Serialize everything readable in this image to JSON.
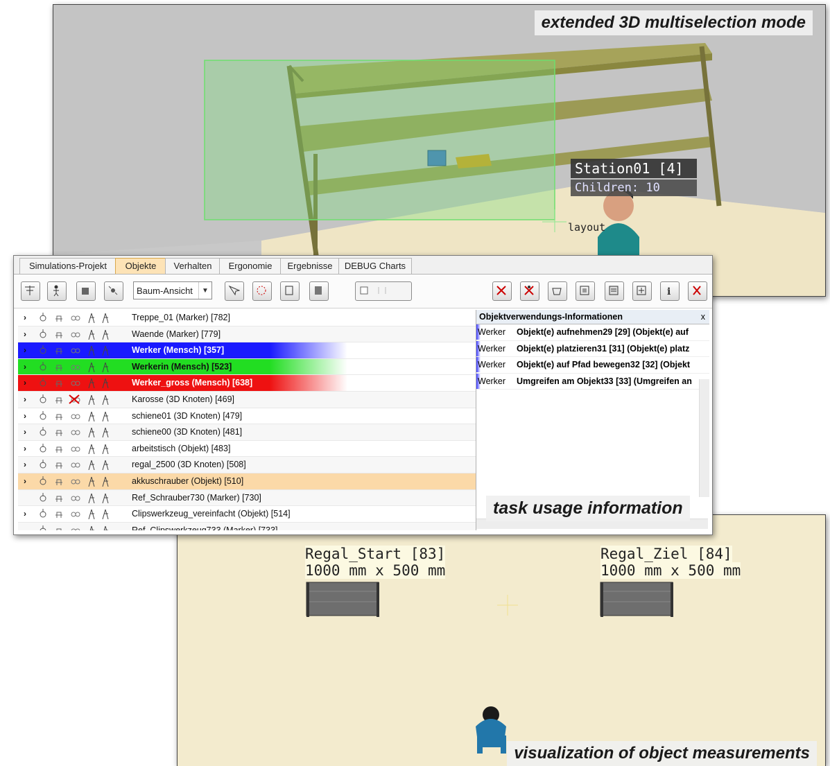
{
  "captions": {
    "top": "extended 3D multiselection mode",
    "middle": "task usage information",
    "bottom": "visualization of object measurements"
  },
  "view3d": {
    "station_label": "Station01 [4]",
    "children_label": "Children: 10",
    "layout_label": "layout"
  },
  "view2d": {
    "shelf_left_name": "Regal_Start [83]",
    "shelf_left_size": "1000 mm x 500 mm",
    "shelf_right_name": "Regal_Ziel [84]",
    "shelf_right_size": "1000 mm x 500 mm"
  },
  "tabs": [
    {
      "label": "Simulations-Projekt",
      "active": false
    },
    {
      "label": "Objekte",
      "active": true
    },
    {
      "label": "Verhalten",
      "active": false
    },
    {
      "label": "Ergonomie",
      "active": false
    },
    {
      "label": "Ergebnisse",
      "active": false
    },
    {
      "label": "DEBUG Charts",
      "active": false
    }
  ],
  "toolbar": {
    "view_select": "Baum-Ansicht"
  },
  "tree": [
    {
      "label": "Treppe_01 (Marker) [782]",
      "expand": true,
      "highlight": ""
    },
    {
      "label": "Waende (Marker) [779]",
      "expand": true,
      "highlight": ""
    },
    {
      "label": "Werker (Mensch) [357]",
      "expand": true,
      "highlight": "blue"
    },
    {
      "label": "Werkerin (Mensch) [523]",
      "expand": true,
      "highlight": "green"
    },
    {
      "label": "Werker_gross (Mensch) [638]",
      "expand": true,
      "highlight": "red"
    },
    {
      "label": "Karosse (3D Knoten) [469]",
      "expand": true,
      "highlight": ""
    },
    {
      "label": "schiene01 (3D Knoten) [479]",
      "expand": true,
      "highlight": ""
    },
    {
      "label": "schiene00 (3D Knoten) [481]",
      "expand": true,
      "highlight": ""
    },
    {
      "label": "arbeitstisch (Objekt) [483]",
      "expand": true,
      "highlight": ""
    },
    {
      "label": "regal_2500 (3D Knoten) [508]",
      "expand": true,
      "highlight": ""
    },
    {
      "label": "akkuschrauber (Objekt) [510]",
      "expand": true,
      "highlight": "selected"
    },
    {
      "label": "Ref_Schrauber730 (Marker) [730]",
      "expand": false,
      "highlight": ""
    },
    {
      "label": "Clipswerkzeug_vereinfacht (Objekt) [514]",
      "expand": true,
      "highlight": ""
    },
    {
      "label": "Ref_Clipswerkzeug733 (Marker) [733]",
      "expand": false,
      "highlight": ""
    }
  ],
  "info": {
    "title": "Objektverwendungs-Informationen",
    "close": "x",
    "rows": [
      {
        "who": "Werker",
        "what": "Objekt(e) aufnehmen29 [29] (Objekt(e) auf"
      },
      {
        "who": "Werker",
        "what": "Objekt(e) platzieren31 [31] (Objekt(e) platz"
      },
      {
        "who": "Werker",
        "what": "Objekt(e) auf Pfad bewegen32 [32] (Objekt"
      },
      {
        "who": "Werker",
        "what": "Umgreifen am Objekt33 [33] (Umgreifen an"
      }
    ]
  },
  "colors": {
    "highlight_blue": "#1a1aff",
    "highlight_green": "#22dd22",
    "highlight_red": "#ee1111",
    "selected_row": "#fbd9a8",
    "tab_active": "#fde3b6"
  }
}
